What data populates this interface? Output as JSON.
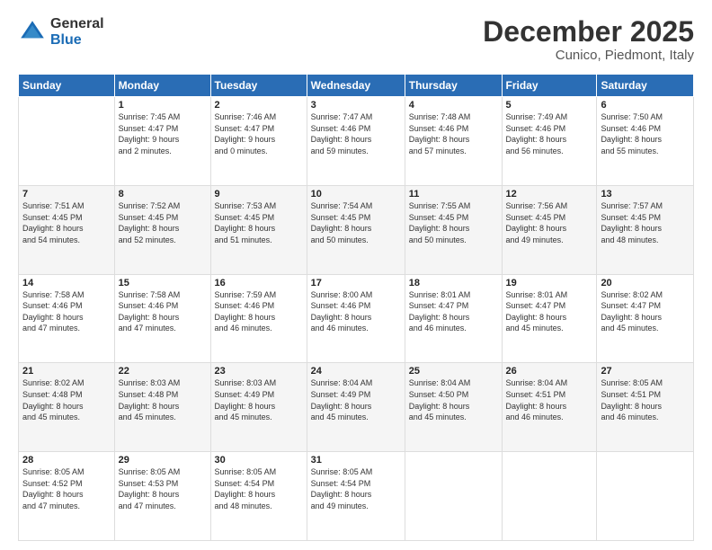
{
  "header": {
    "logo": {
      "general": "General",
      "blue": "Blue"
    },
    "title": "December 2025",
    "subtitle": "Cunico, Piedmont, Italy"
  },
  "calendar": {
    "headers": [
      "Sunday",
      "Monday",
      "Tuesday",
      "Wednesday",
      "Thursday",
      "Friday",
      "Saturday"
    ],
    "weeks": [
      [
        {
          "day": "",
          "sunrise": "",
          "sunset": "",
          "daylight": ""
        },
        {
          "day": "1",
          "sunrise": "Sunrise: 7:45 AM",
          "sunset": "Sunset: 4:47 PM",
          "daylight": "Daylight: 9 hours and 2 minutes."
        },
        {
          "day": "2",
          "sunrise": "Sunrise: 7:46 AM",
          "sunset": "Sunset: 4:47 PM",
          "daylight": "Daylight: 9 hours and 0 minutes."
        },
        {
          "day": "3",
          "sunrise": "Sunrise: 7:47 AM",
          "sunset": "Sunset: 4:46 PM",
          "daylight": "Daylight: 8 hours and 59 minutes."
        },
        {
          "day": "4",
          "sunrise": "Sunrise: 7:48 AM",
          "sunset": "Sunset: 4:46 PM",
          "daylight": "Daylight: 8 hours and 57 minutes."
        },
        {
          "day": "5",
          "sunrise": "Sunrise: 7:49 AM",
          "sunset": "Sunset: 4:46 PM",
          "daylight": "Daylight: 8 hours and 56 minutes."
        },
        {
          "day": "6",
          "sunrise": "Sunrise: 7:50 AM",
          "sunset": "Sunset: 4:46 PM",
          "daylight": "Daylight: 8 hours and 55 minutes."
        }
      ],
      [
        {
          "day": "7",
          "sunrise": "Sunrise: 7:51 AM",
          "sunset": "Sunset: 4:45 PM",
          "daylight": "Daylight: 8 hours and 54 minutes."
        },
        {
          "day": "8",
          "sunrise": "Sunrise: 7:52 AM",
          "sunset": "Sunset: 4:45 PM",
          "daylight": "Daylight: 8 hours and 52 minutes."
        },
        {
          "day": "9",
          "sunrise": "Sunrise: 7:53 AM",
          "sunset": "Sunset: 4:45 PM",
          "daylight": "Daylight: 8 hours and 51 minutes."
        },
        {
          "day": "10",
          "sunrise": "Sunrise: 7:54 AM",
          "sunset": "Sunset: 4:45 PM",
          "daylight": "Daylight: 8 hours and 50 minutes."
        },
        {
          "day": "11",
          "sunrise": "Sunrise: 7:55 AM",
          "sunset": "Sunset: 4:45 PM",
          "daylight": "Daylight: 8 hours and 50 minutes."
        },
        {
          "day": "12",
          "sunrise": "Sunrise: 7:56 AM",
          "sunset": "Sunset: 4:45 PM",
          "daylight": "Daylight: 8 hours and 49 minutes."
        },
        {
          "day": "13",
          "sunrise": "Sunrise: 7:57 AM",
          "sunset": "Sunset: 4:45 PM",
          "daylight": "Daylight: 8 hours and 48 minutes."
        }
      ],
      [
        {
          "day": "14",
          "sunrise": "Sunrise: 7:58 AM",
          "sunset": "Sunset: 4:46 PM",
          "daylight": "Daylight: 8 hours and 47 minutes."
        },
        {
          "day": "15",
          "sunrise": "Sunrise: 7:58 AM",
          "sunset": "Sunset: 4:46 PM",
          "daylight": "Daylight: 8 hours and 47 minutes."
        },
        {
          "day": "16",
          "sunrise": "Sunrise: 7:59 AM",
          "sunset": "Sunset: 4:46 PM",
          "daylight": "Daylight: 8 hours and 46 minutes."
        },
        {
          "day": "17",
          "sunrise": "Sunrise: 8:00 AM",
          "sunset": "Sunset: 4:46 PM",
          "daylight": "Daylight: 8 hours and 46 minutes."
        },
        {
          "day": "18",
          "sunrise": "Sunrise: 8:01 AM",
          "sunset": "Sunset: 4:47 PM",
          "daylight": "Daylight: 8 hours and 46 minutes."
        },
        {
          "day": "19",
          "sunrise": "Sunrise: 8:01 AM",
          "sunset": "Sunset: 4:47 PM",
          "daylight": "Daylight: 8 hours and 45 minutes."
        },
        {
          "day": "20",
          "sunrise": "Sunrise: 8:02 AM",
          "sunset": "Sunset: 4:47 PM",
          "daylight": "Daylight: 8 hours and 45 minutes."
        }
      ],
      [
        {
          "day": "21",
          "sunrise": "Sunrise: 8:02 AM",
          "sunset": "Sunset: 4:48 PM",
          "daylight": "Daylight: 8 hours and 45 minutes."
        },
        {
          "day": "22",
          "sunrise": "Sunrise: 8:03 AM",
          "sunset": "Sunset: 4:48 PM",
          "daylight": "Daylight: 8 hours and 45 minutes."
        },
        {
          "day": "23",
          "sunrise": "Sunrise: 8:03 AM",
          "sunset": "Sunset: 4:49 PM",
          "daylight": "Daylight: 8 hours and 45 minutes."
        },
        {
          "day": "24",
          "sunrise": "Sunrise: 8:04 AM",
          "sunset": "Sunset: 4:49 PM",
          "daylight": "Daylight: 8 hours and 45 minutes."
        },
        {
          "day": "25",
          "sunrise": "Sunrise: 8:04 AM",
          "sunset": "Sunset: 4:50 PM",
          "daylight": "Daylight: 8 hours and 45 minutes."
        },
        {
          "day": "26",
          "sunrise": "Sunrise: 8:04 AM",
          "sunset": "Sunset: 4:51 PM",
          "daylight": "Daylight: 8 hours and 46 minutes."
        },
        {
          "day": "27",
          "sunrise": "Sunrise: 8:05 AM",
          "sunset": "Sunset: 4:51 PM",
          "daylight": "Daylight: 8 hours and 46 minutes."
        }
      ],
      [
        {
          "day": "28",
          "sunrise": "Sunrise: 8:05 AM",
          "sunset": "Sunset: 4:52 PM",
          "daylight": "Daylight: 8 hours and 47 minutes."
        },
        {
          "day": "29",
          "sunrise": "Sunrise: 8:05 AM",
          "sunset": "Sunset: 4:53 PM",
          "daylight": "Daylight: 8 hours and 47 minutes."
        },
        {
          "day": "30",
          "sunrise": "Sunrise: 8:05 AM",
          "sunset": "Sunset: 4:54 PM",
          "daylight": "Daylight: 8 hours and 48 minutes."
        },
        {
          "day": "31",
          "sunrise": "Sunrise: 8:05 AM",
          "sunset": "Sunset: 4:54 PM",
          "daylight": "Daylight: 8 hours and 49 minutes."
        },
        {
          "day": "",
          "sunrise": "",
          "sunset": "",
          "daylight": ""
        },
        {
          "day": "",
          "sunrise": "",
          "sunset": "",
          "daylight": ""
        },
        {
          "day": "",
          "sunrise": "",
          "sunset": "",
          "daylight": ""
        }
      ]
    ]
  }
}
